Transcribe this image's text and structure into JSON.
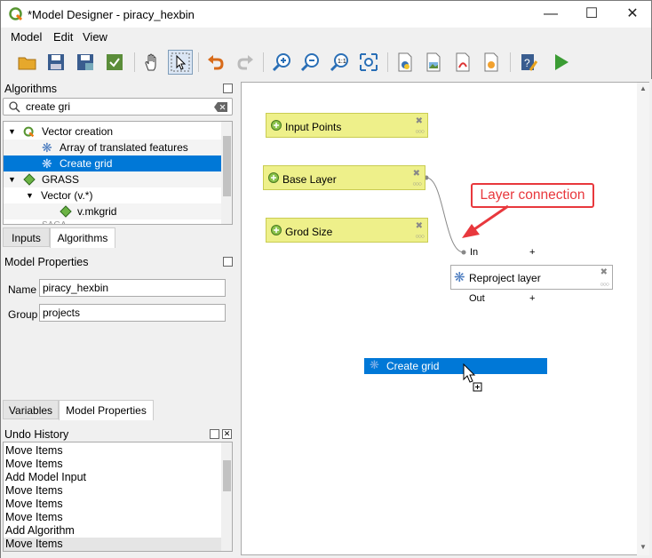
{
  "window": {
    "title": "*Model Designer - piracy_hexbin"
  },
  "menu": {
    "items": [
      "Model",
      "Edit",
      "View"
    ]
  },
  "algorithms_panel": {
    "title": "Algorithms",
    "search_value": "create gri",
    "tree": {
      "vector_creation": "Vector creation",
      "array_translated": "Array of translated features",
      "create_grid": "Create grid",
      "grass": "GRASS",
      "vector_v": "Vector (v.*)",
      "v_mkgrid": "v.mkgrid",
      "saga": "SAGA"
    },
    "tabs": [
      "Inputs",
      "Algorithms"
    ]
  },
  "model_properties": {
    "title": "Model Properties",
    "name_label": "Name",
    "name_value": "piracy_hexbin",
    "group_label": "Group",
    "group_value": "projects",
    "tabs": [
      "Variables",
      "Model Properties"
    ]
  },
  "undo_history": {
    "title": "Undo History",
    "items": [
      "Move Items",
      "Move Items",
      "Add Model Input",
      "Move Items",
      "Move Items",
      "Move Items",
      "Add Algorithm",
      "Move Items"
    ]
  },
  "canvas": {
    "inputs": [
      "Input Points",
      "Base Layer",
      "Grod Size"
    ],
    "algorithm": {
      "label": "Reproject layer",
      "in_label": "In",
      "out_label": "Out",
      "plus": "+"
    },
    "dragging": "Create grid",
    "callout": "Layer connection"
  },
  "colors": {
    "accent": "#0078d7",
    "input_node": "#eef08a",
    "callout": "#e8383d"
  }
}
